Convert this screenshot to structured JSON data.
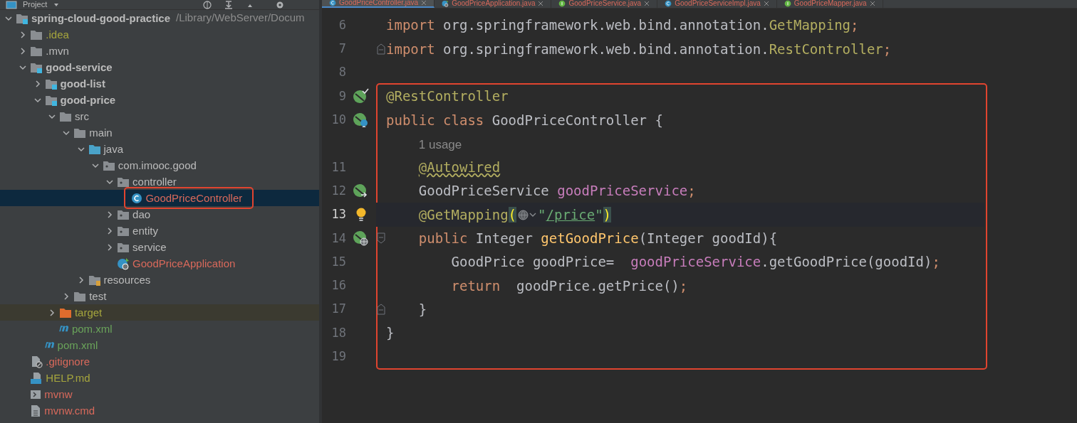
{
  "project_panel": {
    "title": "Project"
  },
  "tree": [
    {
      "label": "spring-cloud-good-practice",
      "path": "/Library/WebServer/Docum",
      "kind": "module",
      "expanded": true,
      "selected": false,
      "color": "#bbbbbb",
      "children": [
        {
          "label": ".idea",
          "kind": "folder",
          "expanded": false,
          "selected": false,
          "color": "#a5a53d"
        },
        {
          "label": ".mvn",
          "kind": "folder",
          "expanded": false,
          "selected": false,
          "color": "#bbbbbb"
        },
        {
          "label": "good-service",
          "kind": "module",
          "expanded": true,
          "selected": false,
          "color": "#bbbbbb",
          "children": [
            {
              "label": "good-list",
              "kind": "module",
              "expanded": false,
              "selected": false,
              "color": "#bbbbbb"
            },
            {
              "label": "good-price",
              "kind": "module",
              "expanded": true,
              "selected": false,
              "color": "#bbbbbb",
              "children": [
                {
                  "label": "src",
                  "kind": "folder",
                  "expanded": true,
                  "selected": false,
                  "color": "#bbbbbb",
                  "children": [
                    {
                      "label": "main",
                      "kind": "folder",
                      "expanded": true,
                      "selected": false,
                      "color": "#bbbbbb",
                      "children": [
                        {
                          "label": "java",
                          "kind": "source-root",
                          "expanded": true,
                          "selected": false,
                          "color": "#bbbbbb",
                          "children": [
                            {
                              "label": "com.imooc.good",
                              "kind": "package",
                              "expanded": true,
                              "selected": false,
                              "color": "#bbbbbb",
                              "children": [
                                {
                                  "label": "controller",
                                  "kind": "package",
                                  "expanded": true,
                                  "selected": false,
                                  "color": "#bbbbbb",
                                  "children": [
                                    {
                                      "label": "GoodPriceController",
                                      "kind": "class",
                                      "selected": true,
                                      "outlined": true,
                                      "color": "#d9695b"
                                    }
                                  ]
                                },
                                {
                                  "label": "dao",
                                  "kind": "package",
                                  "expanded": false,
                                  "selected": false,
                                  "color": "#bbbbbb"
                                },
                                {
                                  "label": "entity",
                                  "kind": "package",
                                  "expanded": false,
                                  "selected": false,
                                  "color": "#bbbbbb"
                                },
                                {
                                  "label": "service",
                                  "kind": "package",
                                  "expanded": false,
                                  "selected": false,
                                  "color": "#bbbbbb"
                                },
                                {
                                  "label": "GoodPriceApplication",
                                  "kind": "spring-app",
                                  "selected": false,
                                  "color": "#d9695b"
                                }
                              ]
                            }
                          ]
                        },
                        {
                          "label": "resources",
                          "kind": "resources-root",
                          "expanded": false,
                          "selected": false,
                          "color": "#bbbbbb"
                        }
                      ]
                    },
                    {
                      "label": "test",
                      "kind": "folder",
                      "expanded": false,
                      "selected": false,
                      "color": "#bbbbbb"
                    }
                  ]
                },
                {
                  "label": "target",
                  "kind": "excluded-folder",
                  "expanded": false,
                  "selected": false,
                  "color": "#a5a53d"
                },
                {
                  "label": "pom.xml",
                  "kind": "maven",
                  "selected": false,
                  "color": "#6aa45a"
                }
              ]
            },
            {
              "label": "pom.xml",
              "kind": "maven",
              "selected": false,
              "color": "#6aa45a"
            }
          ]
        },
        {
          "label": ".gitignore",
          "kind": "gitignore",
          "selected": false,
          "color": "#d9695b"
        },
        {
          "label": "HELP.md",
          "kind": "markdown",
          "selected": false,
          "color": "#a5a53d"
        },
        {
          "label": "mvnw",
          "kind": "script",
          "selected": false,
          "color": "#d9695b"
        },
        {
          "label": "mvnw.cmd",
          "kind": "text-file",
          "selected": false,
          "color": "#d9695b"
        }
      ]
    }
  ],
  "tabs": [
    {
      "label": "GoodPriceController.java",
      "kind": "class",
      "selected": true
    },
    {
      "label": "GoodPriceApplication.java",
      "kind": "spring-app",
      "selected": false
    },
    {
      "label": "GoodPriceService.java",
      "kind": "interface",
      "selected": false
    },
    {
      "label": "GoodPriceServiceImpl.java",
      "kind": "class",
      "selected": false
    },
    {
      "label": "GoodPriceMapper.java",
      "kind": "interface",
      "selected": false
    }
  ],
  "editor": {
    "lines": [
      {
        "number": "6",
        "tokens": [
          {
            "text": "import ",
            "kind": "keyword"
          },
          {
            "text": "org.springframework.web.bind.annotation.",
            "kind": "plain"
          },
          {
            "text": "GetMapping",
            "kind": "annotation"
          },
          {
            "text": ";",
            "kind": "keyword"
          }
        ]
      },
      {
        "number": "7",
        "fold": {
          "kind": "end"
        },
        "tokens": [
          {
            "text": "import ",
            "kind": "keyword"
          },
          {
            "text": "org.springframework.web.bind.annotation.",
            "kind": "plain"
          },
          {
            "text": "RestController",
            "kind": "annotation"
          },
          {
            "text": ";",
            "kind": "keyword"
          }
        ]
      },
      {
        "number": "8"
      }
    ],
    "framed_lines": [
      {
        "number": "9",
        "gutter": {
          "kind": "bean"
        },
        "tokens": [
          {
            "text": "@RestController",
            "kind": "annotation"
          }
        ]
      },
      {
        "number": "10",
        "gutter": {
          "kind": "bean-web"
        },
        "tokens": [
          {
            "text": "public class ",
            "kind": "keyword"
          },
          {
            "text": "GoodPriceController {",
            "kind": "plain"
          }
        ]
      },
      {
        "tokens": [
          {
            "text": "    1 usage",
            "kind": "hint"
          }
        ]
      },
      {
        "number": "11",
        "tokens": [
          {
            "text": "    @Autowired",
            "kind": "annotation",
            "warning": true
          }
        ]
      },
      {
        "number": "12",
        "gutter": {
          "kind": "bean-link"
        },
        "tokens": [
          {
            "text": "    GoodPriceService ",
            "kind": "plain"
          },
          {
            "text": "goodPriceService",
            "kind": "field"
          },
          {
            "text": ";",
            "kind": "keyword"
          }
        ]
      },
      {
        "number": "13",
        "gutter": {
          "kind": "bulb"
        },
        "current": true,
        "tokens": [
          {
            "text": "    @GetMapping",
            "kind": "annotation"
          },
          {
            "text": "(",
            "kind": "brace-match"
          },
          {
            "text": "\"",
            "kind": "string"
          },
          {
            "text": "/price",
            "kind": "link"
          },
          {
            "text": "\"",
            "kind": "string"
          },
          {
            "text": ")",
            "kind": "brace-match"
          }
        ]
      },
      {
        "number": "14",
        "gutter": {
          "kind": "web-endpoint"
        },
        "fold": {
          "kind": "start"
        },
        "tokens": [
          {
            "text": "    public ",
            "kind": "keyword"
          },
          {
            "text": "Integer ",
            "kind": "plain"
          },
          {
            "text": "getGoodPrice",
            "kind": "method"
          },
          {
            "text": "(Integer goodId){",
            "kind": "plain"
          }
        ]
      },
      {
        "number": "15",
        "tokens": [
          {
            "text": "        GoodPrice goodPrice=  ",
            "kind": "plain"
          },
          {
            "text": "goodPriceService",
            "kind": "field"
          },
          {
            "text": ".getGoodPrice(goodId)",
            "kind": "plain"
          },
          {
            "text": ";",
            "kind": "keyword"
          }
        ]
      },
      {
        "number": "16",
        "tokens": [
          {
            "text": "        return  ",
            "kind": "keyword"
          },
          {
            "text": "goodPrice.getPrice()",
            "kind": "plain"
          },
          {
            "text": ";",
            "kind": "keyword"
          }
        ]
      },
      {
        "number": "17",
        "fold": {
          "kind": "end"
        },
        "tokens": [
          {
            "text": "    }",
            "kind": "plain"
          }
        ]
      },
      {
        "number": "18",
        "tokens": [
          {
            "text": "}",
            "kind": "plain"
          }
        ]
      },
      {
        "number": "19"
      }
    ]
  }
}
